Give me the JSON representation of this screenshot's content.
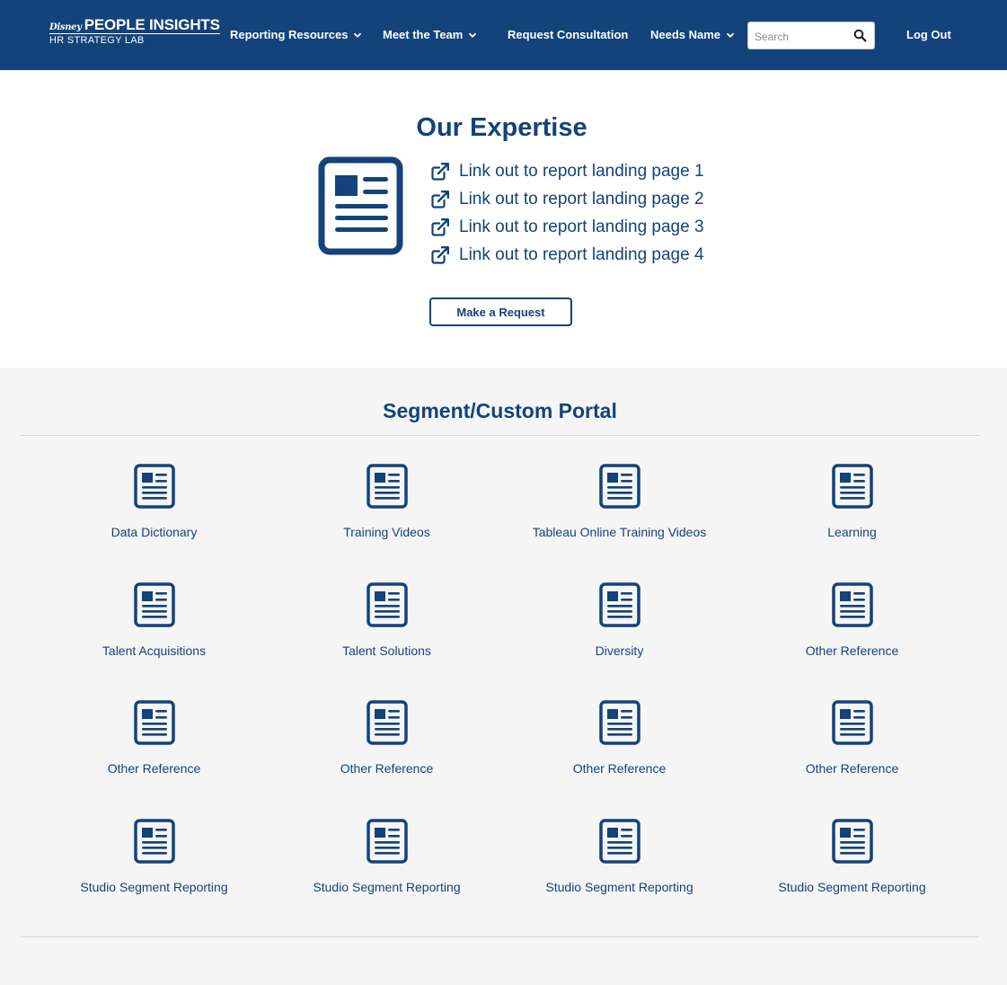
{
  "brand": {
    "disney": "Disney",
    "title": "PEOPLE INSIGHTS",
    "subtitle": "HR STRATEGY LAB"
  },
  "nav": {
    "reporting_resources": "Reporting Resources",
    "meet_the_team": "Meet the Team",
    "request_consultation": "Request Consultation",
    "needs_name": "Needs Name",
    "search_placeholder": "Search",
    "search_value": "",
    "logout": "Log Out"
  },
  "expertise": {
    "title": "Our Expertise",
    "links": [
      "Link out to report landing page 1",
      "Link out to report landing page 2",
      "Link out to report landing page 3",
      "Link out to report landing page 4"
    ],
    "button": "Make a Request"
  },
  "portal": {
    "title": "Segment/Custom Portal",
    "tiles": [
      "Data Dictionary",
      "Training Videos",
      "Tableau Online Training Videos",
      "Learning",
      "Talent Acquisitions",
      "Talent Solutions",
      "Diversity",
      "Other Reference",
      "Other Reference",
      "Other Reference",
      "Other Reference",
      "Other Reference",
      "Studio Segment Reporting",
      "Studio Segment Reporting",
      "Studio Segment Reporting",
      "Studio Segment Reporting"
    ]
  },
  "colors": {
    "brand_blue": "#14427a",
    "page_bg": "#f5f5f5",
    "white": "#ffffff"
  },
  "icons": {
    "document": "document-icon",
    "external_link": "external-link-icon",
    "search": "search-icon",
    "chevron": "chevron-down-icon"
  }
}
